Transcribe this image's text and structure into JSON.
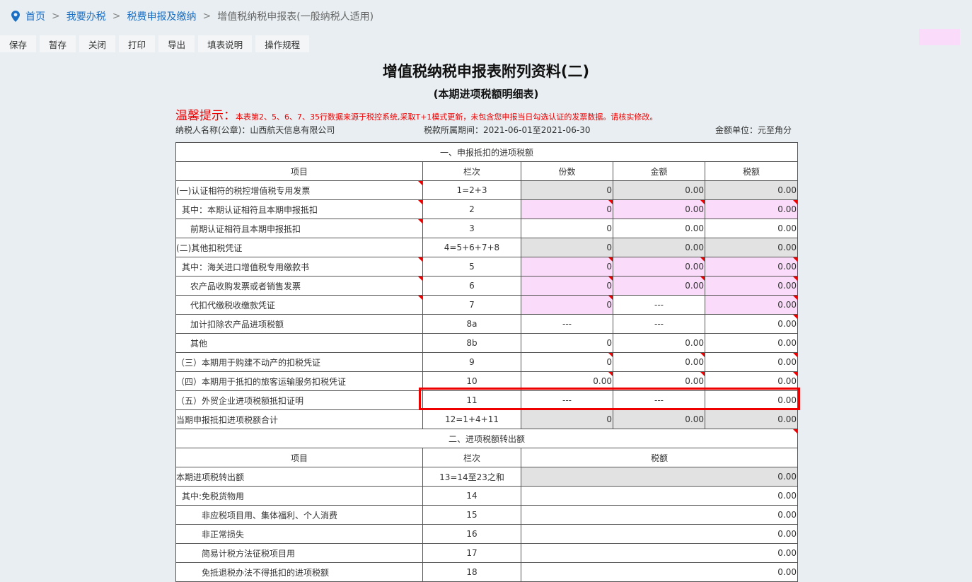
{
  "breadcrumb": [
    "首页",
    "我要办税",
    "税费申报及缴纳",
    "增值税纳税申报表(一般纳税人适用)"
  ],
  "toolbar": [
    "保存",
    "暂存",
    "关闭",
    "打印",
    "导出",
    "填表说明",
    "操作规程"
  ],
  "title": "增值税纳税申报表附列资料(二)",
  "subtitle": "(本期进项税额明细表)",
  "tip": {
    "label": "温馨提示：",
    "text": "本表第2、5、6、7、35行数据来源于税控系统,采取T+1模式更新，未包含您申报当日勾选认证的发票数据。请核实修改。"
  },
  "info": {
    "taxpayer": "纳税人名称(公章)：山西航天信息有限公司",
    "period": "税款所属期间：2021-06-01至2021-06-30",
    "unit": "金额单位：元至角分"
  },
  "section1": {
    "title": "一、申报抵扣的进项税额",
    "headers": [
      "项目",
      "栏次",
      "份数",
      "金额",
      "税额"
    ],
    "rows": [
      {
        "label": "(一)认证相符的税控增值税专用发票",
        "indent": 0,
        "col": "1=2+3",
        "count": "0",
        "amount": "0.00",
        "tax": "0.00",
        "bg": [
          "gray",
          "gray",
          "gray"
        ],
        "mark_label": true,
        "marks": [
          false,
          false,
          false
        ]
      },
      {
        "label": "其中：本期认证相符且本期申报抵扣",
        "indent": 1,
        "col": "2",
        "count": "0",
        "amount": "0.00",
        "tax": "0.00",
        "bg": [
          "pink",
          "pink",
          "pink"
        ],
        "mark_label": true,
        "marks": [
          true,
          true,
          true
        ]
      },
      {
        "label": "前期认证相符且本期申报抵扣",
        "indent": 2,
        "col": "3",
        "count": "0",
        "amount": "0.00",
        "tax": "0.00",
        "bg": [
          "white",
          "white",
          "white"
        ],
        "mark_label": true,
        "marks": [
          false,
          false,
          false
        ]
      },
      {
        "label": "(二)其他扣税凭证",
        "indent": 0,
        "col": "4=5+6+7+8",
        "count": "0",
        "amount": "0.00",
        "tax": "0.00",
        "bg": [
          "gray",
          "gray",
          "gray"
        ],
        "mark_label": false,
        "marks": [
          false,
          false,
          false
        ]
      },
      {
        "label": "其中：海关进口增值税专用缴款书",
        "indent": 1,
        "col": "5",
        "count": "0",
        "amount": "0.00",
        "tax": "0.00",
        "bg": [
          "pink",
          "pink",
          "pink"
        ],
        "mark_label": true,
        "marks": [
          true,
          true,
          true
        ]
      },
      {
        "label": "农产品收购发票或者销售发票",
        "indent": 2,
        "col": "6",
        "count": "0",
        "amount": "0.00",
        "tax": "0.00",
        "bg": [
          "pink",
          "pink",
          "pink"
        ],
        "mark_label": true,
        "marks": [
          true,
          true,
          true
        ]
      },
      {
        "label": "代扣代缴税收缴款凭证",
        "indent": 2,
        "col": "7",
        "count": "0",
        "amount": "---",
        "tax": "0.00",
        "bg": [
          "pink",
          "white",
          "pink"
        ],
        "mark_label": true,
        "marks": [
          true,
          false,
          true
        ]
      },
      {
        "label": "加计扣除农产品进项税额",
        "indent": 2,
        "col": "8a",
        "count": "---",
        "amount": "---",
        "tax": "0.00",
        "bg": [
          "white",
          "white",
          "white"
        ],
        "mark_label": false,
        "marks": [
          false,
          false,
          true
        ]
      },
      {
        "label": "其他",
        "indent": 2,
        "col": "8b",
        "count": "0",
        "amount": "0.00",
        "tax": "0.00",
        "bg": [
          "white",
          "white",
          "white"
        ],
        "mark_label": false,
        "marks": [
          false,
          false,
          false
        ]
      },
      {
        "label": "（三）本期用于购建不动产的扣税凭证",
        "indent": 0,
        "col": "9",
        "count": "0",
        "amount": "0.00",
        "tax": "0.00",
        "bg": [
          "white",
          "white",
          "white"
        ],
        "mark_label": false,
        "marks": [
          true,
          true,
          true
        ]
      },
      {
        "label": "（四）本期用于抵扣的旅客运输服务扣税凭证",
        "indent": 0,
        "col": "10",
        "count": "0.00",
        "amount": "0.00",
        "tax": "0.00",
        "bg": [
          "white",
          "white",
          "white"
        ],
        "mark_label": false,
        "marks": [
          true,
          true,
          true
        ]
      },
      {
        "label": "（五）外贸企业进项税额抵扣证明",
        "indent": 0,
        "col": "11",
        "count": "---",
        "amount": "---",
        "tax": "0.00",
        "bg": [
          "white",
          "white",
          "white"
        ],
        "mark_label": false,
        "marks": [
          false,
          false,
          false
        ]
      },
      {
        "label": "当期申报抵扣进项税额合计",
        "indent": 0,
        "col": "12=1+4+11",
        "count": "0",
        "amount": "0.00",
        "tax": "0.00",
        "bg": [
          "gray",
          "gray",
          "gray"
        ],
        "mark_label": false,
        "marks": [
          false,
          false,
          false
        ]
      }
    ]
  },
  "section2": {
    "title": "二、进项税额转出额",
    "headers": [
      "项目",
      "栏次",
      "税额"
    ],
    "rows": [
      {
        "label": "本期进项税转出额",
        "indent": 0,
        "col": "13=14至23之和",
        "tax": "0.00",
        "bg": "gray"
      },
      {
        "label": "其中:免税货物用",
        "indent": 1,
        "col": "14",
        "tax": "0.00",
        "bg": "white"
      },
      {
        "label": "非应税项目用、集体福利、个人消费",
        "indent": 3,
        "col": "15",
        "tax": "0.00",
        "bg": "white"
      },
      {
        "label": "非正常损失",
        "indent": 3,
        "col": "16",
        "tax": "0.00",
        "bg": "white"
      },
      {
        "label": "简易计税方法征税项目用",
        "indent": 3,
        "col": "17",
        "tax": "0.00",
        "bg": "white"
      },
      {
        "label": "免抵退税办法不得抵扣的进项税额",
        "indent": 3,
        "col": "18",
        "tax": "0.00",
        "bg": "white"
      }
    ]
  }
}
